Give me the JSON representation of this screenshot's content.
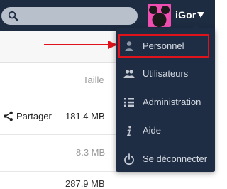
{
  "header": {
    "search_placeholder": "",
    "user_name": "iGor"
  },
  "files": {
    "size_column_header": "Taille",
    "rows": [
      {
        "action_label": "Partager",
        "size": "181.4 MB"
      },
      {
        "size": "8.3 MB"
      },
      {
        "size": "287.9 MB"
      }
    ]
  },
  "user_menu": {
    "items": [
      {
        "label": "Personnel",
        "icon": "person-icon",
        "highlighted": true
      },
      {
        "label": "Utilisateurs",
        "icon": "users-icon"
      },
      {
        "label": "Administration",
        "icon": "list-icon"
      },
      {
        "label": "Aide",
        "icon": "info-icon"
      },
      {
        "label": "Se déconnecter",
        "icon": "power-icon"
      }
    ]
  },
  "colors": {
    "header_bg": "#1e2c42",
    "menu_bg": "#1f2d44",
    "avatar_bg": "#f04fb1",
    "highlight_red": "#e0131c"
  }
}
